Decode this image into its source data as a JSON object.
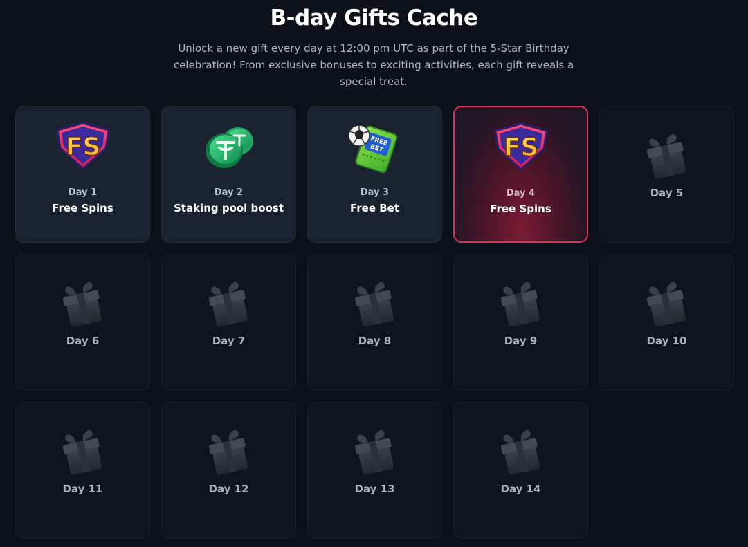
{
  "header": {
    "title": "B-day Gifts Cache",
    "subtitle": "Unlock a new gift every day at 12:00 pm UTC as part of the 5-Star Birthday celebration! From exclusive bonuses to exciting activities, each gift reveals a special treat."
  },
  "colors": {
    "background": "#0c1119",
    "card_locked": "#0f151e",
    "card_opened": "#1a2230",
    "active_border": "#e0305a"
  },
  "cards": [
    {
      "day": "Day 1",
      "name": "Free Spins",
      "state": "opened",
      "icon": "free-spins-icon"
    },
    {
      "day": "Day 2",
      "name": "Staking pool boost",
      "state": "opened",
      "icon": "staking-coin-icon"
    },
    {
      "day": "Day 3",
      "name": "Free Bet",
      "state": "opened",
      "icon": "free-bet-ticket-icon"
    },
    {
      "day": "Day 4",
      "name": "Free Spins",
      "state": "active",
      "icon": "free-spins-icon"
    },
    {
      "day": "Day 5",
      "state": "locked",
      "icon": "gift-box-icon"
    },
    {
      "day": "Day 6",
      "state": "locked",
      "icon": "gift-box-icon"
    },
    {
      "day": "Day 7",
      "state": "locked",
      "icon": "gift-box-icon"
    },
    {
      "day": "Day 8",
      "state": "locked",
      "icon": "gift-box-icon"
    },
    {
      "day": "Day 9",
      "state": "locked",
      "icon": "gift-box-icon"
    },
    {
      "day": "Day 10",
      "state": "locked",
      "icon": "gift-box-icon"
    },
    {
      "day": "Day 11",
      "state": "locked",
      "icon": "gift-box-icon"
    },
    {
      "day": "Day 12",
      "state": "locked",
      "icon": "gift-box-icon"
    },
    {
      "day": "Day 13",
      "state": "locked",
      "icon": "gift-box-icon"
    },
    {
      "day": "Day 14",
      "state": "locked",
      "icon": "gift-box-icon"
    }
  ],
  "icon_text": {
    "free_spins": "FS",
    "free_bet": "FREE BET"
  }
}
